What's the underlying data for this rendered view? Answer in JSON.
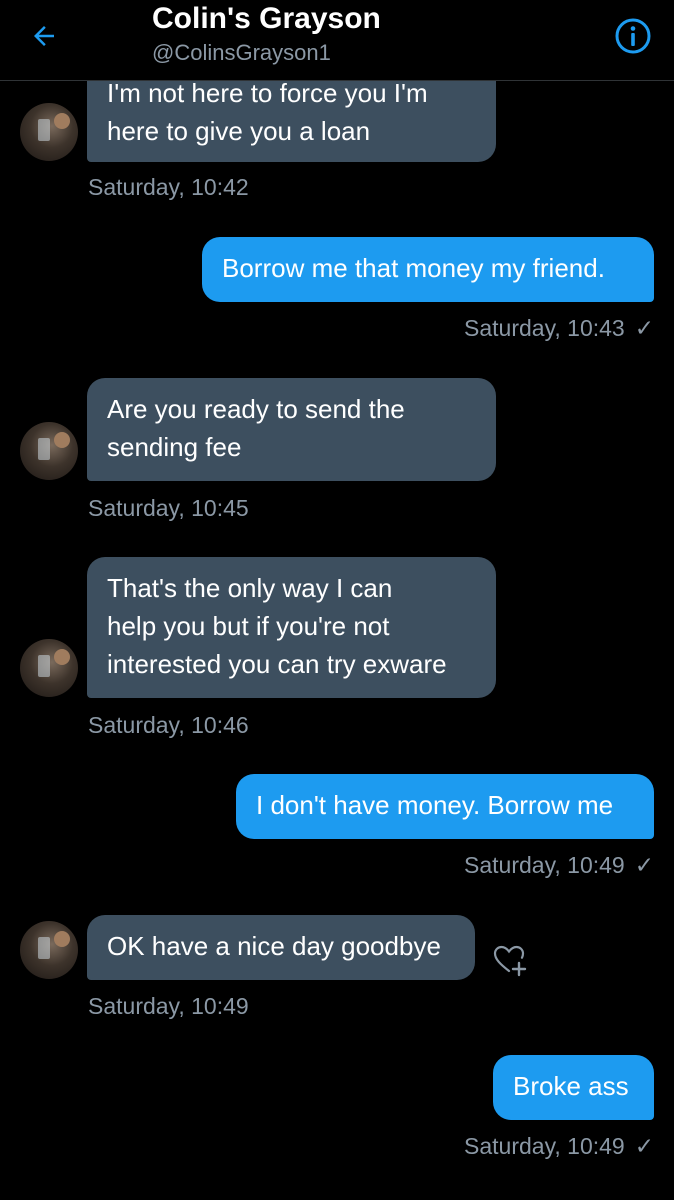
{
  "header": {
    "title": "Colin's Grayson",
    "handle": "@ColinsGrayson1",
    "back_icon": "arrow-left-icon",
    "info_icon": "info-circle-icon",
    "accent_color": "#1d9bf0"
  },
  "messages": [
    {
      "direction": "in",
      "lines": [
        "I'm not here to force you I'm",
        "here to give you a loan"
      ],
      "timestamp": "Saturday, 10:42"
    },
    {
      "direction": "out",
      "lines": [
        "Borrow me that money my friend."
      ],
      "timestamp": "Saturday, 10:43",
      "read_mark": "✓"
    },
    {
      "direction": "in",
      "lines": [
        "Are you ready to send the",
        "sending fee"
      ],
      "timestamp": "Saturday, 10:45"
    },
    {
      "direction": "in",
      "lines": [
        "That's the only way I can",
        "help you but if you're not",
        "interested you can try exware"
      ],
      "timestamp": "Saturday, 10:46"
    },
    {
      "direction": "out",
      "lines": [
        "I don't have money. Borrow me"
      ],
      "timestamp": "Saturday, 10:49",
      "read_mark": "✓"
    },
    {
      "direction": "in",
      "lines": [
        "OK have a nice day goodbye"
      ],
      "timestamp": "Saturday, 10:49",
      "reaction_icon": "heart-plus-icon"
    },
    {
      "direction": "out",
      "lines": [
        "Broke ass"
      ],
      "timestamp": "Saturday, 10:49",
      "read_mark": "✓"
    }
  ],
  "colors": {
    "incoming_bubble": "#3d4f5f",
    "outgoing_bubble": "#1d9bf0",
    "timestamp_text": "#8b98a5",
    "background": "#000000"
  }
}
